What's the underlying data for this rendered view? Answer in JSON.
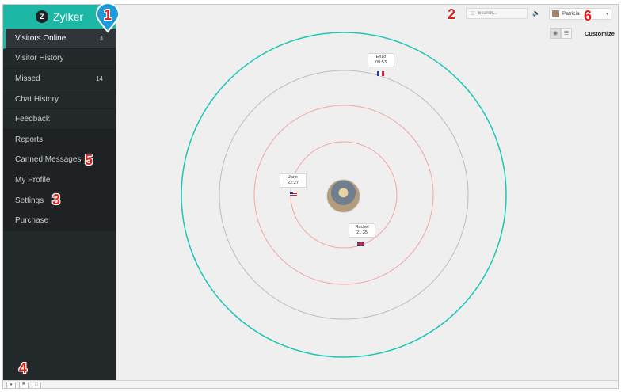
{
  "brand": {
    "name": "Zylker",
    "logo_letter": "Z"
  },
  "sidebar": {
    "items": [
      {
        "label": "Visitors Online",
        "count": "3"
      },
      {
        "label": "Visitor History",
        "count": ""
      },
      {
        "label": "Missed",
        "count": "14"
      },
      {
        "label": "Chat History",
        "count": ""
      },
      {
        "label": "Feedback",
        "count": ""
      },
      {
        "label": "Reports",
        "count": ""
      },
      {
        "label": "Canned Messages",
        "count": ""
      },
      {
        "label": "My Profile",
        "count": ""
      },
      {
        "label": "Settings",
        "count": ""
      },
      {
        "label": "Purchase",
        "count": ""
      }
    ]
  },
  "header": {
    "search_placeholder": "Search...",
    "user_name": "Patricia",
    "customize_label": "Customize"
  },
  "visitors": [
    {
      "name": "Enzo",
      "time": "09:53",
      "flag": "fr"
    },
    {
      "name": "Jane",
      "time": "22:27",
      "flag": "us"
    },
    {
      "name": "Rachel",
      "time": "21:35",
      "flag": "gb"
    }
  ],
  "callouts": {
    "c1": "1",
    "c2": "2",
    "c3": "3",
    "c4": "4",
    "c5": "5",
    "c6": "6"
  },
  "colors": {
    "accent": "#1cb8a5",
    "sidebar": "#23282b",
    "ring_inner": "#f2a5a5",
    "ring_outer": "#1cc7b4",
    "callout": "#e0211b"
  },
  "icons": {
    "search": "search-icon",
    "speaker": "speaker-icon",
    "radar_view": "radar-view-icon",
    "list_view": "list-view-icon"
  }
}
